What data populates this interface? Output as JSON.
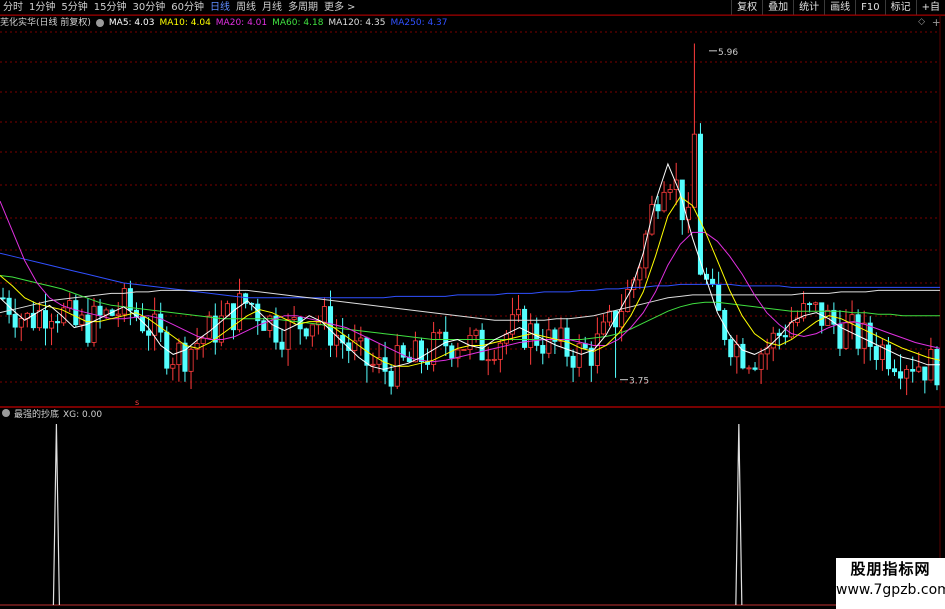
{
  "toolbar": {
    "timeframes": [
      {
        "label": "分时",
        "name": "tf-intraday"
      },
      {
        "label": "1分钟",
        "name": "tf-1min"
      },
      {
        "label": "5分钟",
        "name": "tf-5min"
      },
      {
        "label": "15分钟",
        "name": "tf-15min"
      },
      {
        "label": "30分钟",
        "name": "tf-30min"
      },
      {
        "label": "60分钟",
        "name": "tf-60min"
      },
      {
        "label": "日线",
        "name": "tf-daily",
        "active": true
      },
      {
        "label": "周线",
        "name": "tf-weekly"
      },
      {
        "label": "月线",
        "name": "tf-monthly"
      },
      {
        "label": "多周期",
        "name": "tf-multi"
      },
      {
        "label": "更多",
        "name": "tf-more"
      }
    ],
    "more_arrow": ">",
    "buttons": [
      {
        "label": "复权",
        "name": "adjust-button"
      },
      {
        "label": "叠加",
        "name": "overlay-button"
      },
      {
        "label": "统计",
        "name": "stats-button"
      },
      {
        "label": "画线",
        "name": "draw-line-button"
      },
      {
        "label": "F10",
        "name": "f10-button"
      },
      {
        "label": "标记",
        "name": "mark-button"
      },
      {
        "label": "+自",
        "name": "add-watchlist-button"
      }
    ]
  },
  "main_legend": {
    "title": "芜化实华(日线 前复权)",
    "items": [
      {
        "label": "MA5: 4.03",
        "color": "#ffffff"
      },
      {
        "label": "MA10: 4.04",
        "color": "#ffff00"
      },
      {
        "label": "MA20: 4.01",
        "color": "#e030e0"
      },
      {
        "label": "MA60: 4.18",
        "color": "#40e040"
      },
      {
        "label": "MA120: 4.35",
        "color": "#dddddd"
      },
      {
        "label": "MA250: 4.37",
        "color": "#3050ff"
      }
    ],
    "corner_icon": "◇",
    "corner_button": "+"
  },
  "price_labels": {
    "high": "5.96",
    "low": "3.75"
  },
  "signal_marker": "s",
  "sub_legend": {
    "title": "最强的抄底",
    "value": "XG: 0.00"
  },
  "watermark": {
    "title": "股朋指标网",
    "url": "www.7gpzb.com"
  },
  "colors": {
    "up": "#ff3c3c",
    "down": "#54ffff",
    "grid": "#7a0000",
    "background": "#000000"
  },
  "chart_data": {
    "type": "candlestick",
    "price_range": [
      3.75,
      5.96
    ],
    "ma5": [
      4.3,
      4.22,
      4.15,
      4.2,
      4.25,
      4.18,
      4.1,
      4.12,
      4.16,
      4.2,
      4.24,
      4.18,
      4.1,
      3.98,
      3.92,
      3.95,
      4.02,
      4.08,
      4.15,
      4.22,
      4.28,
      4.2,
      4.12,
      4.08,
      4.12,
      4.18,
      4.14,
      4.06,
      3.98,
      3.9,
      3.84,
      3.82,
      3.84,
      3.86,
      3.9,
      3.95,
      4.0,
      4.02,
      3.98,
      3.96,
      4.02,
      4.06,
      4.1,
      4.06,
      4.02,
      3.98,
      3.95,
      3.92,
      3.95,
      4.05,
      4.2,
      4.35,
      4.6,
      4.95,
      5.2,
      5.0,
      4.7,
      4.45,
      4.2,
      4.05,
      3.95,
      3.92,
      3.96,
      4.04,
      4.14,
      4.18,
      4.2,
      4.16,
      4.1,
      4.06,
      4.02,
      3.98,
      3.94,
      3.9,
      3.88,
      3.85,
      3.85
    ],
    "ma10": [
      4.45,
      4.38,
      4.3,
      4.26,
      4.24,
      4.22,
      4.18,
      4.14,
      4.14,
      4.16,
      4.18,
      4.2,
      4.16,
      4.1,
      4.04,
      3.98,
      3.96,
      4.0,
      4.06,
      4.12,
      4.18,
      4.22,
      4.2,
      4.16,
      4.12,
      4.14,
      4.14,
      4.1,
      4.04,
      3.98,
      3.92,
      3.87,
      3.84,
      3.84,
      3.86,
      3.88,
      3.92,
      3.96,
      3.98,
      3.98,
      4.0,
      4.02,
      4.04,
      4.06,
      4.04,
      4.02,
      4.0,
      3.96,
      3.94,
      3.98,
      4.06,
      4.18,
      4.34,
      4.58,
      4.85,
      4.98,
      4.92,
      4.75,
      4.55,
      4.35,
      4.18,
      4.06,
      4.0,
      3.98,
      4.02,
      4.08,
      4.14,
      4.18,
      4.16,
      4.12,
      4.08,
      4.04,
      4.0,
      3.96,
      3.93,
      3.9,
      3.88
    ],
    "ma20": [
      4.95,
      4.75,
      4.55,
      4.4,
      4.3,
      4.25,
      4.22,
      4.2,
      4.18,
      4.16,
      4.16,
      4.17,
      4.18,
      4.16,
      4.12,
      4.08,
      4.04,
      4.02,
      4.02,
      4.04,
      4.08,
      4.12,
      4.15,
      4.18,
      4.18,
      4.16,
      4.14,
      4.12,
      4.1,
      4.06,
      4.02,
      3.98,
      3.94,
      3.9,
      3.88,
      3.87,
      3.88,
      3.9,
      3.92,
      3.94,
      3.96,
      3.98,
      4.0,
      4.01,
      4.02,
      4.02,
      4.02,
      4.0,
      3.98,
      3.98,
      4.02,
      4.1,
      4.2,
      4.34,
      4.52,
      4.66,
      4.74,
      4.74,
      4.68,
      4.58,
      4.46,
      4.32,
      4.2,
      4.12,
      4.06,
      4.04,
      4.06,
      4.1,
      4.13,
      4.14,
      4.12,
      4.09,
      4.06,
      4.03,
      4.0,
      3.98,
      3.96
    ],
    "ma60": [
      4.45,
      4.44,
      4.42,
      4.4,
      4.38,
      4.36,
      4.33,
      4.3,
      4.27,
      4.25,
      4.24,
      4.23,
      4.22,
      4.21,
      4.2,
      4.19,
      4.18,
      4.17,
      4.16,
      4.16,
      4.16,
      4.16,
      4.16,
      4.15,
      4.14,
      4.13,
      4.12,
      4.1,
      4.09,
      4.08,
      4.07,
      4.06,
      4.05,
      4.04,
      4.03,
      4.02,
      4.02,
      4.02,
      4.02,
      4.02,
      4.02,
      4.02,
      4.02,
      4.02,
      4.02,
      4.02,
      4.02,
      4.02,
      4.03,
      4.04,
      4.06,
      4.09,
      4.13,
      4.17,
      4.21,
      4.24,
      4.26,
      4.27,
      4.27,
      4.26,
      4.25,
      4.24,
      4.23,
      4.22,
      4.21,
      4.21,
      4.21,
      4.21,
      4.21,
      4.2,
      4.2,
      4.19,
      4.19,
      4.18,
      4.18,
      4.18,
      4.18
    ],
    "ma120": [
      4.2,
      4.22,
      4.24,
      4.26,
      4.28,
      4.29,
      4.3,
      4.31,
      4.32,
      4.33,
      4.33,
      4.34,
      4.34,
      4.35,
      4.35,
      4.35,
      4.35,
      4.35,
      4.35,
      4.35,
      4.35,
      4.34,
      4.33,
      4.32,
      4.31,
      4.3,
      4.29,
      4.28,
      4.27,
      4.26,
      4.25,
      4.24,
      4.23,
      4.22,
      4.21,
      4.2,
      4.19,
      4.18,
      4.17,
      4.16,
      4.15,
      4.15,
      4.15,
      4.15,
      4.15,
      4.16,
      4.16,
      4.17,
      4.18,
      4.2,
      4.22,
      4.24,
      4.26,
      4.28,
      4.3,
      4.31,
      4.32,
      4.32,
      4.32,
      4.32,
      4.32,
      4.32,
      4.32,
      4.32,
      4.32,
      4.33,
      4.33,
      4.33,
      4.34,
      4.34,
      4.34,
      4.35,
      4.35,
      4.35,
      4.35,
      4.35,
      4.35
    ],
    "ma250": [
      4.6,
      4.58,
      4.56,
      4.54,
      4.52,
      4.5,
      4.48,
      4.46,
      4.44,
      4.42,
      4.4,
      4.39,
      4.38,
      4.37,
      4.36,
      4.35,
      4.34,
      4.33,
      4.32,
      4.31,
      4.3,
      4.3,
      4.3,
      4.3,
      4.3,
      4.3,
      4.3,
      4.3,
      4.3,
      4.3,
      4.3,
      4.3,
      4.31,
      4.31,
      4.31,
      4.31,
      4.31,
      4.32,
      4.32,
      4.32,
      4.32,
      4.33,
      4.33,
      4.33,
      4.34,
      4.34,
      4.34,
      4.35,
      4.35,
      4.36,
      4.36,
      4.37,
      4.37,
      4.38,
      4.38,
      4.39,
      4.39,
      4.39,
      4.39,
      4.39,
      4.38,
      4.38,
      4.38,
      4.38,
      4.37,
      4.37,
      4.37,
      4.37,
      4.37,
      4.37,
      4.37,
      4.37,
      4.37,
      4.37,
      4.37,
      4.37,
      4.37
    ],
    "candle_count": 155,
    "xg_signals": [
      {
        "bar_fraction": 0.06,
        "value": 1
      },
      {
        "bar_fraction": 0.786,
        "value": 1
      }
    ]
  }
}
